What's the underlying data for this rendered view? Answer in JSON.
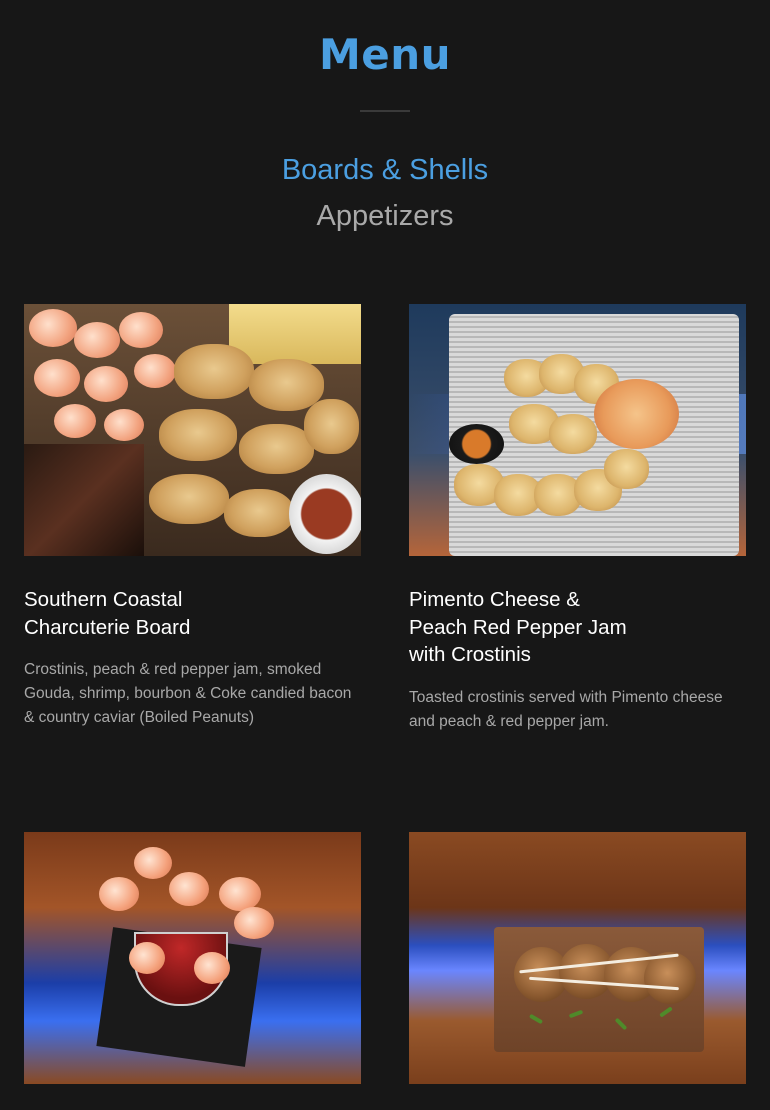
{
  "page": {
    "title": "Menu"
  },
  "section": {
    "title": "Boards & Shells",
    "subtitle": "Appetizers"
  },
  "items": [
    {
      "name": "Southern Coastal\nCharcuterie Board",
      "description": "Crostinis, peach & red pepper jam, smoked Gouda, shrimp, bourbon & Coke candied bacon & country caviar (Boiled Peanuts)"
    },
    {
      "name": "Pimento Cheese &\nPeach Red Pepper Jam\nwith Crostinis",
      "description": "Toasted crostinis served with Pimento cheese and peach & red pepper jam."
    },
    {
      "name": "",
      "description": ""
    },
    {
      "name": "",
      "description": ""
    }
  ],
  "colors": {
    "accent": "#4b9fe1",
    "background": "#171717",
    "muted_text": "#a8a8a8"
  }
}
